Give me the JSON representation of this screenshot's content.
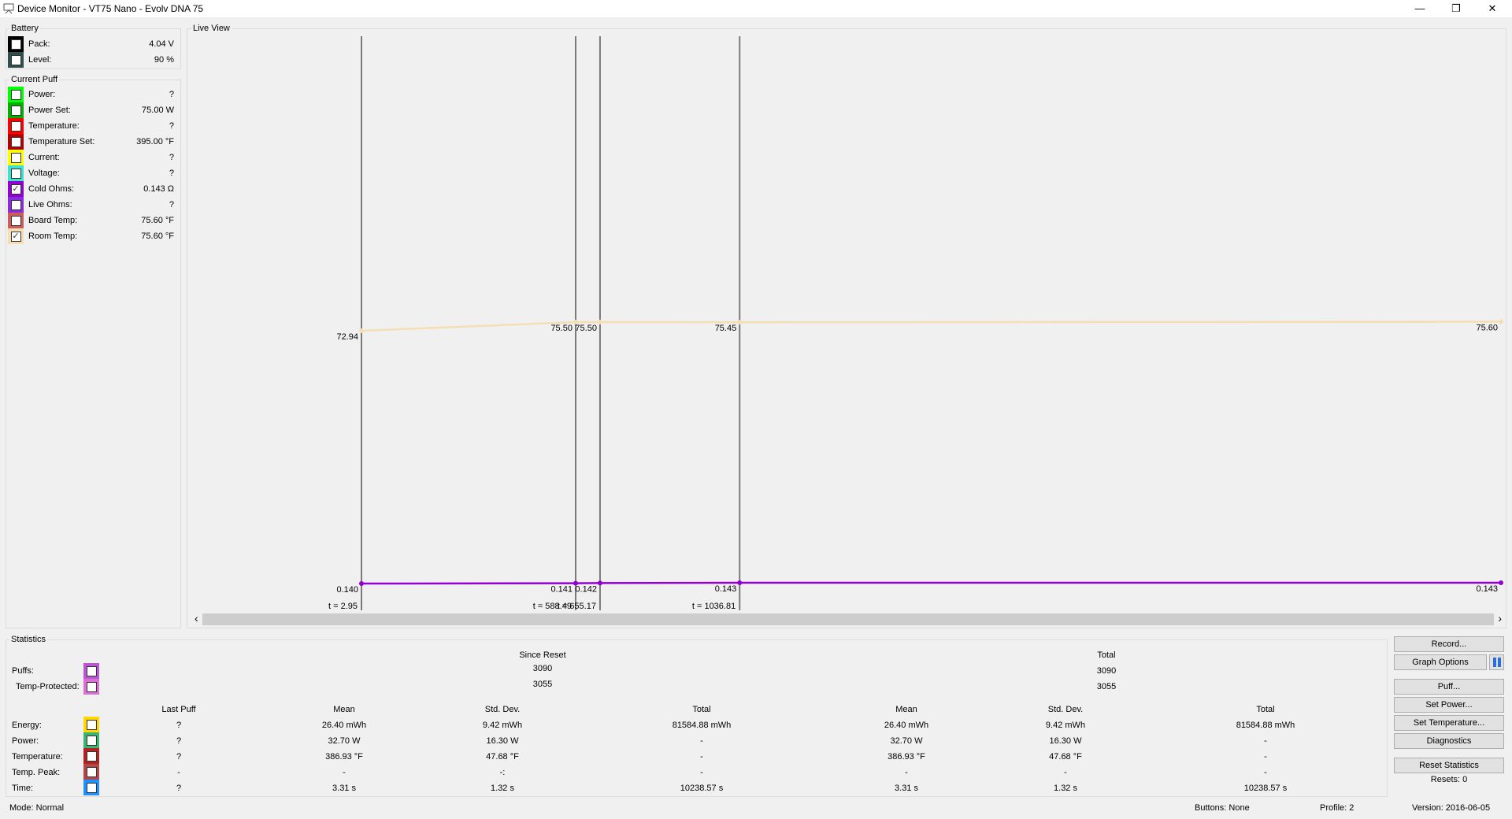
{
  "window": {
    "title": "Device Monitor - VT75 Nano - Evolv DNA 75",
    "minimize": "—",
    "restore": "❐",
    "close": "✕"
  },
  "battery": {
    "label": "Battery",
    "items": [
      {
        "label": "Pack:",
        "value": "4.04 V",
        "color": "#000000",
        "checked": false
      },
      {
        "label": "Level:",
        "value": "90 %",
        "color": "#2f4f4f",
        "checked": false
      }
    ]
  },
  "current_puff": {
    "label": "Current Puff",
    "items": [
      {
        "label": "Power:",
        "value": "?",
        "color": "#00ff00",
        "checked": false
      },
      {
        "label": "Power Set:",
        "value": "75.00 W",
        "color": "#00b000",
        "checked": false
      },
      {
        "label": "Temperature:",
        "value": "?",
        "color": "#ff0000",
        "checked": false
      },
      {
        "label": "Temperature Set:",
        "value": "395.00 °F",
        "color": "#b40000",
        "checked": false
      },
      {
        "label": "Current:",
        "value": "?",
        "color": "#ffff00",
        "checked": false
      },
      {
        "label": "Voltage:",
        "value": "?",
        "color": "#40e0d0",
        "checked": false
      },
      {
        "label": "Cold Ohms:",
        "value": "0.143 Ω",
        "color": "#9400d3",
        "checked": true
      },
      {
        "label": "Live Ohms:",
        "value": "?",
        "color": "#8a2be2",
        "checked": false
      },
      {
        "label": "Board Temp:",
        "value": "75.60 °F",
        "color": "#cd5c5c",
        "checked": false
      },
      {
        "label": "Room Temp:",
        "value": "75.60 °F",
        "color": "#f5deb3",
        "checked": true
      }
    ]
  },
  "live_view": {
    "label": "Live View",
    "markers": [
      {
        "t_label": "t = 2.95",
        "t": 2.95
      },
      {
        "t_label": "t = 588.49",
        "t": 588.49
      },
      {
        "t_label": "t = 655.17",
        "t": 655.17
      },
      {
        "t_label": "t = 1036.81",
        "t": 1036.81
      }
    ],
    "series": [
      {
        "name": "Room Temp",
        "color": "#f5deb3",
        "points": [
          {
            "t": 2.95,
            "v": 72.94,
            "label": "72.94"
          },
          {
            "t": 588.49,
            "v": 75.5,
            "label": "75.50"
          },
          {
            "t": 655.17,
            "v": 75.5,
            "label": "75.50"
          },
          {
            "t": 1036.81,
            "v": 75.45,
            "label": "75.45"
          },
          {
            "t": null,
            "v": 75.6,
            "label": "75.60"
          }
        ]
      },
      {
        "name": "Cold Ohms",
        "color": "#9400d3",
        "points": [
          {
            "t": 2.95,
            "v": 0.14,
            "label": "0.140"
          },
          {
            "t": 588.49,
            "v": 0.141,
            "label": "0.141"
          },
          {
            "t": 655.17,
            "v": 0.142,
            "label": "0.142"
          },
          {
            "t": 1036.81,
            "v": 0.143,
            "label": "0.143"
          },
          {
            "t": null,
            "v": 0.143,
            "label": "0.143"
          }
        ]
      }
    ],
    "scroll_left": "‹",
    "scroll_right": "›"
  },
  "statistics": {
    "label": "Statistics",
    "since_reset": "Since Reset",
    "total": "Total",
    "counts": [
      {
        "label": "Puffs:",
        "color": "#ba55d3",
        "since_reset": "3090",
        "total": "3090"
      },
      {
        "label": "Temp-Protected:",
        "color": "#da70d6",
        "since_reset": "3055",
        "total": "3055"
      }
    ],
    "columns": [
      "Last Puff",
      "Mean",
      "Std. Dev.",
      "Total",
      "Mean",
      "Std. Dev.",
      "Total"
    ],
    "rows": [
      {
        "label": "Energy:",
        "color": "#ffd700",
        "values": [
          "?",
          "26.40 mWh",
          "9.42 mWh",
          "81584.88 mWh",
          "26.40 mWh",
          "9.42 mWh",
          "81584.88 mWh"
        ]
      },
      {
        "label": "Power:",
        "color": "#3cb371",
        "values": [
          "?",
          "32.70 W",
          "16.30 W",
          "-",
          "32.70 W",
          "16.30 W",
          "-"
        ]
      },
      {
        "label": "Temperature:",
        "color": "#b22222",
        "values": [
          "?",
          "386.93 °F",
          "47.68 °F",
          "-",
          "386.93 °F",
          "47.68 °F",
          "-"
        ]
      },
      {
        "label": "Temp. Peak:",
        "color": "#b04848",
        "values": [
          "-",
          "-",
          "-:",
          "-",
          "-",
          "-",
          "-"
        ]
      },
      {
        "label": "Time:",
        "color": "#1e90ff",
        "values": [
          "?",
          "3.31 s",
          "1.32 s",
          "10238.57 s",
          "3.31 s",
          "1.32 s",
          "10238.57 s"
        ]
      }
    ]
  },
  "buttons": {
    "record": "Record...",
    "graph_options": "Graph Options",
    "puff": "Puff...",
    "set_power": "Set Power...",
    "set_temperature": "Set Temperature...",
    "diagnostics": "Diagnostics",
    "reset_statistics": "Reset Statistics",
    "resets": "Resets: 0"
  },
  "status": {
    "mode": "Mode: Normal",
    "buttons": "Buttons: None",
    "profile": "Profile: 2",
    "version": "Version: 2016-06-05"
  }
}
